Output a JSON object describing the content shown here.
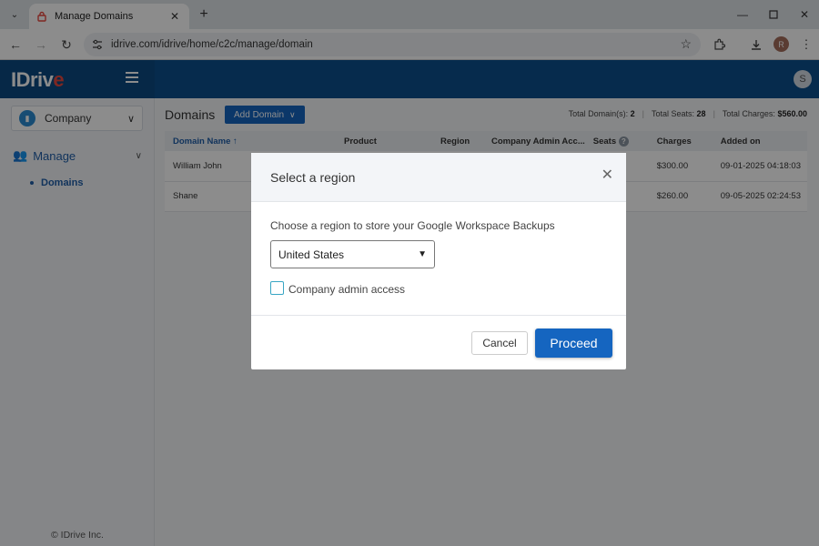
{
  "browser": {
    "tab_title": "Manage Domains",
    "url": "idrive.com/idrive/home/c2c/manage/domain",
    "profile_initial": "R"
  },
  "header": {
    "logo_text": "IDriv",
    "logo_e": "e",
    "user_initial": "S"
  },
  "sidebar": {
    "company_label": "Company",
    "manage_label": "Manage",
    "domains_label": "Domains",
    "footer": "© IDrive Inc."
  },
  "main": {
    "title": "Domains",
    "add_domain_label": "Add Domain",
    "stats": {
      "total_domains_label": "Total Domain(s):",
      "total_domains_value": "2",
      "total_seats_label": "Total Seats:",
      "total_seats_value": "28",
      "total_charges_label": "Total Charges:",
      "total_charges_value": "$560.00"
    },
    "table": {
      "columns": [
        "Domain Name",
        "Product",
        "Region",
        "Company Admin Acc...",
        "Seats",
        "Charges",
        "Added on"
      ],
      "sort_indicator": "↑",
      "rows": [
        {
          "domain": "William John",
          "product": "",
          "region": "",
          "admin": "",
          "seats": "",
          "charges": "$300.00",
          "added": "09-01-2025 04:18:03"
        },
        {
          "domain": "Shane",
          "product": "",
          "region": "",
          "admin": "",
          "seats": "",
          "charges": "$260.00",
          "added": "09-05-2025 02:24:53"
        }
      ]
    }
  },
  "modal": {
    "title": "Select a region",
    "label": "Choose a region to store your Google Workspace Backups",
    "region_selected": "United States",
    "checkbox_label": "Company admin access",
    "cancel_label": "Cancel",
    "proceed_label": "Proceed"
  },
  "colors": {
    "brand_blue": "#0b4f8c",
    "primary_button": "#1565c0",
    "logo_accent": "#e8483e"
  }
}
